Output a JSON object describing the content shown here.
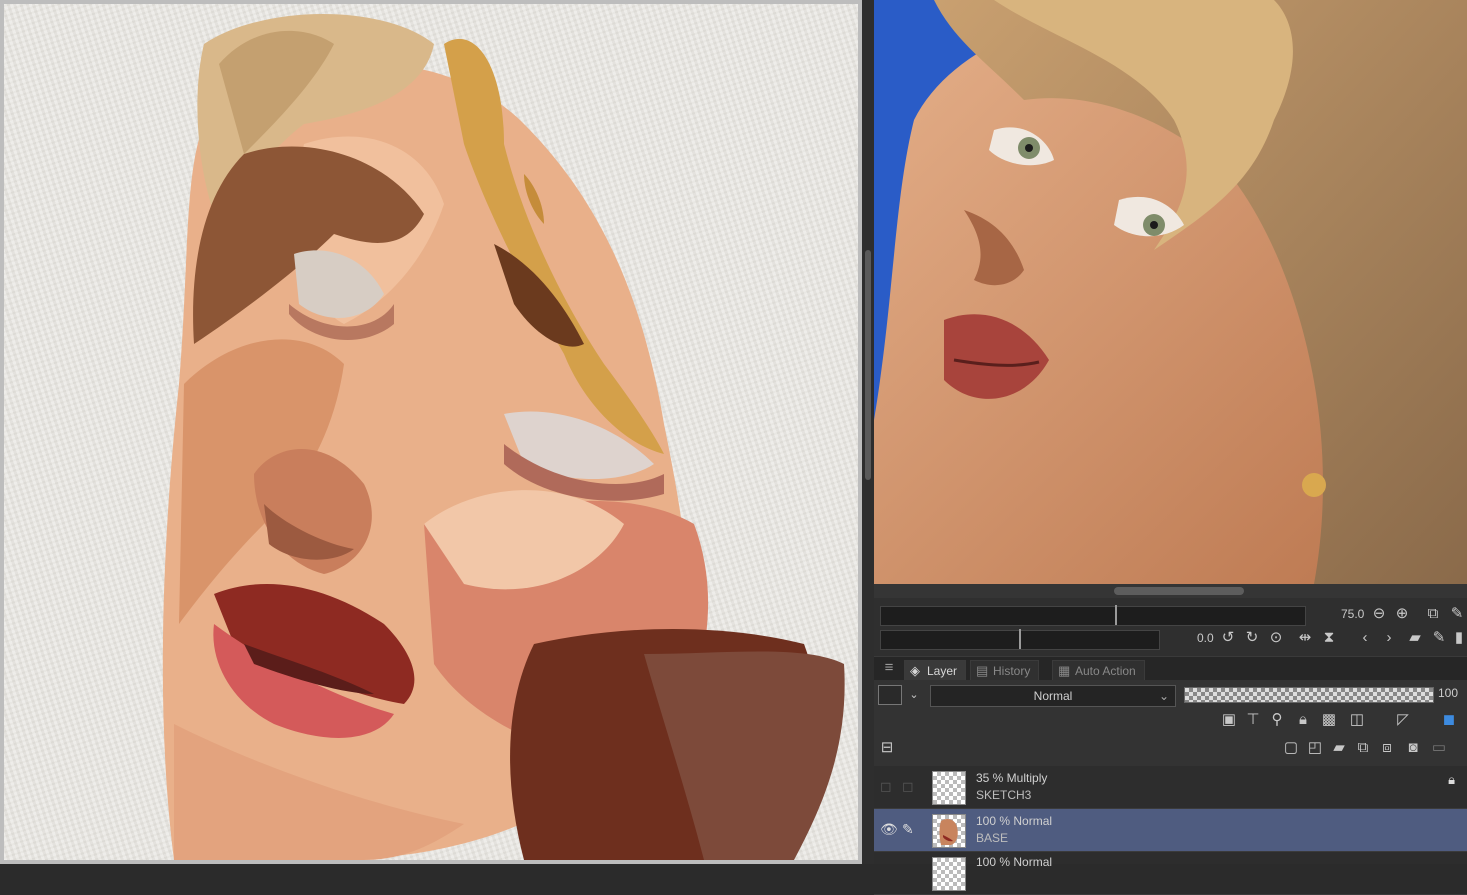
{
  "reference_panel": {
    "zoom_value": "75.0",
    "rotation_value": "0.0"
  },
  "layer_panel": {
    "tabs": [
      {
        "label": "Layer",
        "active": true
      },
      {
        "label": "History",
        "active": false
      },
      {
        "label": "Auto Action",
        "active": false
      }
    ],
    "blend_mode": "Normal",
    "opacity": "100",
    "layers": [
      {
        "mode": "35 % Multiply",
        "name": "SKETCH3",
        "locked": true,
        "selected": false
      },
      {
        "mode": "100 % Normal",
        "name": "BASE",
        "locked": false,
        "selected": true
      },
      {
        "mode": "100 % Normal",
        "name": "",
        "locked": false,
        "selected": false
      }
    ]
  },
  "icons": {
    "zoom_out": "zoom-out-icon",
    "zoom_in": "zoom-in-icon",
    "lock": "lock-icon",
    "eye": "eye-icon",
    "pen": "pen-icon"
  },
  "colors": {
    "selected_layer": "#4f5c80",
    "reference_background": "#2a5cc7"
  }
}
